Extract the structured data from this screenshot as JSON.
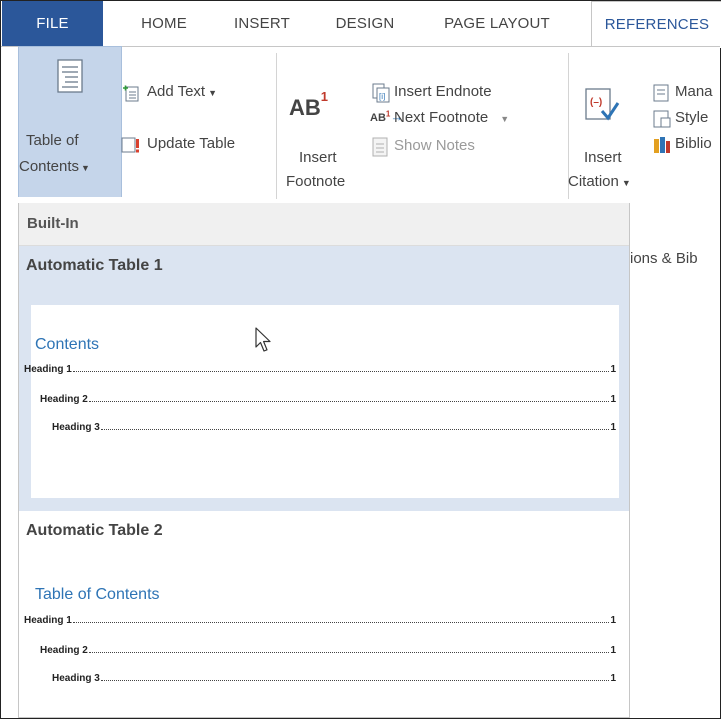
{
  "tabs": [
    {
      "label": "FILE"
    },
    {
      "label": "HOME"
    },
    {
      "label": "INSERT"
    },
    {
      "label": "DESIGN"
    },
    {
      "label": "PAGE LAYOUT"
    },
    {
      "label": "REFERENCES"
    }
  ],
  "ribbon": {
    "toc_line1": "Table of",
    "toc_line2": "Contents",
    "add_text": "Add Text",
    "update_table": "Update Table",
    "insert_footnote_line1": "Insert",
    "insert_footnote_line2": "Footnote",
    "footnote_icon_text": "AB",
    "footnote_icon_sup": "1",
    "insert_endnote": "Insert Endnote",
    "next_footnote": "Next Footnote",
    "show_notes": "Show Notes",
    "insert_citation_line1": "Insert",
    "insert_citation_line2": "Citation",
    "manage_sources": "Mana",
    "style": "Style",
    "bibliography": "Biblio",
    "group_label": "ions & Bib"
  },
  "dropdown": {
    "header": "Built-In",
    "items": [
      {
        "title": "Automatic Table 1",
        "heading": "Contents",
        "entries": [
          {
            "label": "Heading 1",
            "page": "1"
          },
          {
            "label": "Heading 2",
            "page": "1"
          },
          {
            "label": "Heading 3",
            "page": "1"
          }
        ]
      },
      {
        "title": "Automatic Table 2",
        "heading": "Table of Contents",
        "entries": [
          {
            "label": "Heading 1",
            "page": "1"
          },
          {
            "label": "Heading 2",
            "page": "1"
          },
          {
            "label": "Heading 3",
            "page": "1"
          }
        ]
      }
    ]
  },
  "colors": {
    "file_tab": "#2b579a",
    "selected_item": "#dbe4f1",
    "toc_heading": "#2e74b5"
  }
}
